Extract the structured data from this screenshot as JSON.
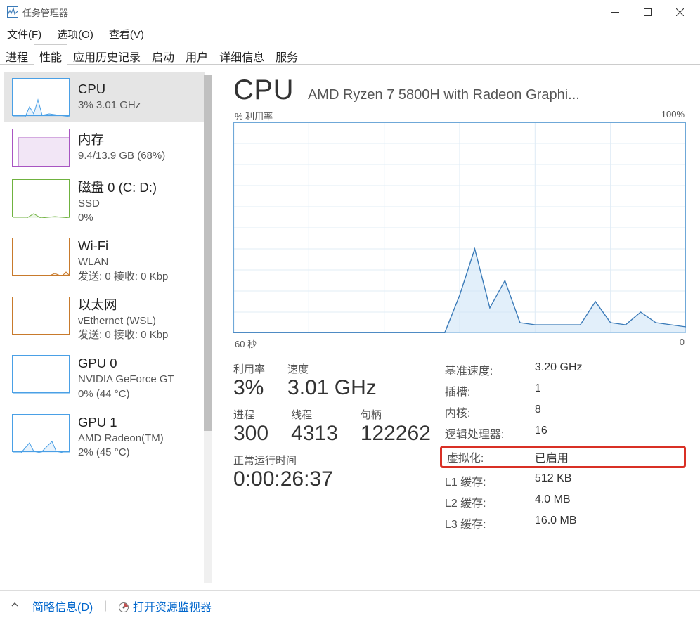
{
  "window": {
    "title": "任务管理器"
  },
  "menus": {
    "file": "文件(F)",
    "options": "选项(O)",
    "view": "查看(V)"
  },
  "tabs": {
    "processes": "进程",
    "performance": "性能",
    "apphistory": "应用历史记录",
    "startup": "启动",
    "users": "用户",
    "details": "详细信息",
    "services": "服务"
  },
  "sidebar": [
    {
      "title": "CPU",
      "sub1": "3%  3.01 GHz",
      "color": "#4aa0e6"
    },
    {
      "title": "内存",
      "sub1": "9.4/13.9 GB (68%)",
      "color": "#a955c2"
    },
    {
      "title": "磁盘 0 (C: D:)",
      "sub1": "SSD",
      "sub2": "0%",
      "color": "#6fb23f"
    },
    {
      "title": "Wi-Fi",
      "sub1": "WLAN",
      "sub2": "发送: 0  接收: 0 Kbp",
      "color": "#c87a2c"
    },
    {
      "title": "以太网",
      "sub1": "vEthernet (WSL)",
      "sub2": "发送: 0  接收: 0 Kbp",
      "color": "#c87a2c"
    },
    {
      "title": "GPU 0",
      "sub1": "NVIDIA GeForce GT",
      "sub2": "0% (44 °C)",
      "color": "#4aa0e6"
    },
    {
      "title": "GPU 1",
      "sub1": "AMD Radeon(TM) ",
      "sub2": "2% (45 °C)",
      "color": "#4aa0e6"
    }
  ],
  "detail": {
    "title": "CPU",
    "subtitle": "AMD Ryzen 7 5800H with Radeon Graphi...",
    "chart_top_left": "% 利用率",
    "chart_top_right": "100%",
    "chart_bottom_left": "60 秒",
    "chart_bottom_right": "0",
    "util_label": "利用率",
    "util_value": "3%",
    "speed_label": "速度",
    "speed_value": "3.01 GHz",
    "proc_label": "进程",
    "proc_value": "300",
    "thread_label": "线程",
    "thread_value": "4313",
    "handle_label": "句柄",
    "handle_value": "122262",
    "uptime_label": "正常运行时间",
    "uptime_value": "0:00:26:37",
    "right": {
      "base_speed_l": "基准速度:",
      "base_speed_v": "3.20 GHz",
      "sockets_l": "插槽:",
      "sockets_v": "1",
      "cores_l": "内核:",
      "cores_v": "8",
      "logical_l": "逻辑处理器:",
      "logical_v": "16",
      "virt_l": "虚拟化:",
      "virt_v": "已启用",
      "l1_l": "L1 缓存:",
      "l1_v": "512 KB",
      "l2_l": "L2 缓存:",
      "l2_v": "4.0 MB",
      "l3_l": "L3 缓存:",
      "l3_v": "16.0 MB"
    }
  },
  "footer": {
    "fewer": "简略信息(D)",
    "open_monitor": "打开资源监视器"
  },
  "chart_data": {
    "type": "line",
    "title": "% 利用率",
    "xlabel": "60 秒",
    "ylabel": "",
    "ylim": [
      0,
      100
    ],
    "xlim": [
      60,
      0
    ],
    "x": [
      60,
      58,
      56,
      54,
      52,
      50,
      48,
      46,
      44,
      42,
      40,
      38,
      36,
      34,
      32,
      30,
      28,
      26,
      24,
      22,
      20,
      18,
      16,
      14,
      12,
      10,
      8,
      6,
      4,
      2,
      0
    ],
    "values": [
      0,
      0,
      0,
      0,
      0,
      0,
      0,
      0,
      0,
      0,
      0,
      0,
      0,
      0,
      0,
      18,
      40,
      12,
      25,
      5,
      4,
      4,
      4,
      4,
      15,
      5,
      4,
      10,
      5,
      4,
      3
    ]
  }
}
